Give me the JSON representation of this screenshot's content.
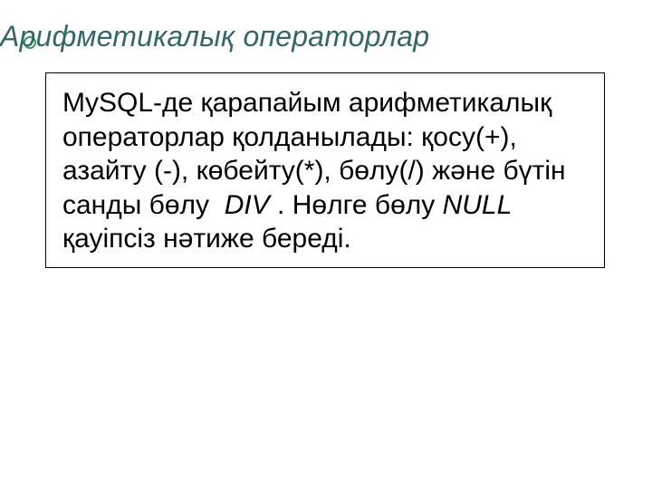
{
  "title": "Арифметикалық операторлар",
  "body": {
    "r1": "MySQL-де қарапайым арифметикалық операторлар қолданылады: қосу(+), азайту (-), көбейту(*), бөлу(/) және бүтін санды бөлу  ",
    "r2": "DIV",
    "r3": " . Нөлге бөлу ",
    "r4": "NULL",
    "r5": " қауіпсіз нәтиже береді."
  }
}
